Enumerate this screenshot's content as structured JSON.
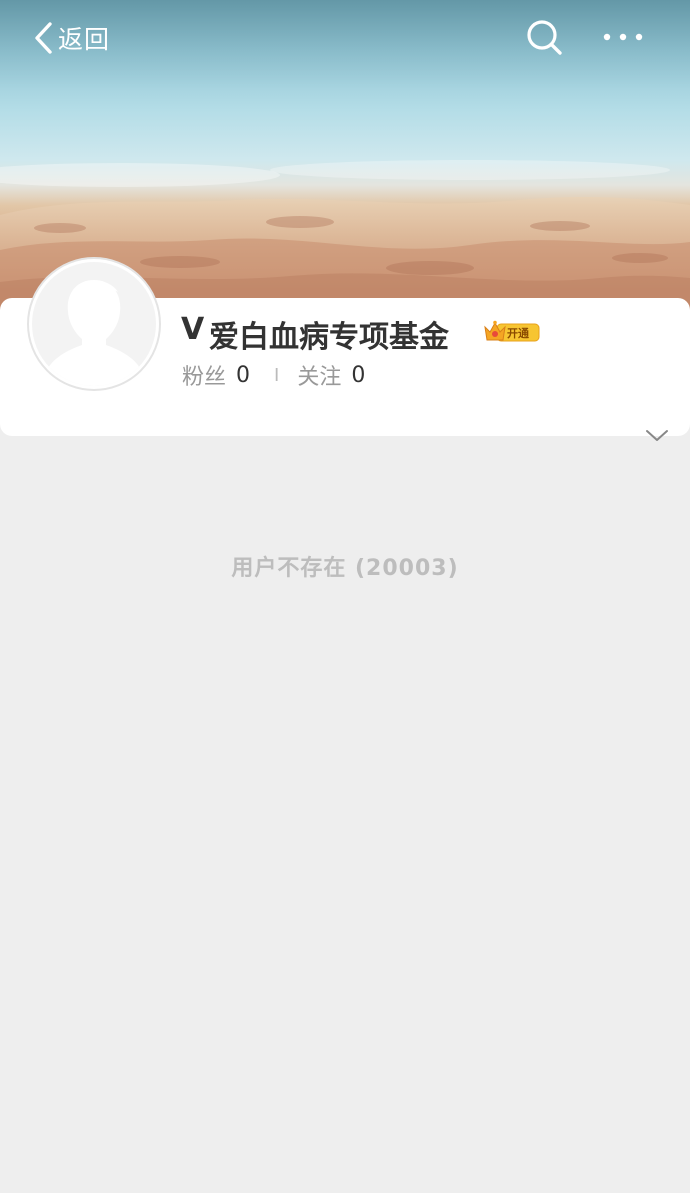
{
  "nav": {
    "back_label": "返回",
    "icons": [
      "chevron-left-icon",
      "search-icon",
      "more-icon"
    ]
  },
  "profile": {
    "verified_mark": "V",
    "name": "爱白血病专项基金",
    "vip_badge_label": "开通",
    "followers_label": "粉丝",
    "followers_count": "0",
    "following_label": "关注",
    "following_count": "0",
    "divider": "I"
  },
  "message": {
    "text": "用户不存在 (20003)"
  },
  "colors": {
    "background": "#eeeeee",
    "card": "#ffffff",
    "name_text": "#333333",
    "label_text": "#999999",
    "message_text": "#bdbdbd",
    "badge_orange": "#f5a623"
  }
}
